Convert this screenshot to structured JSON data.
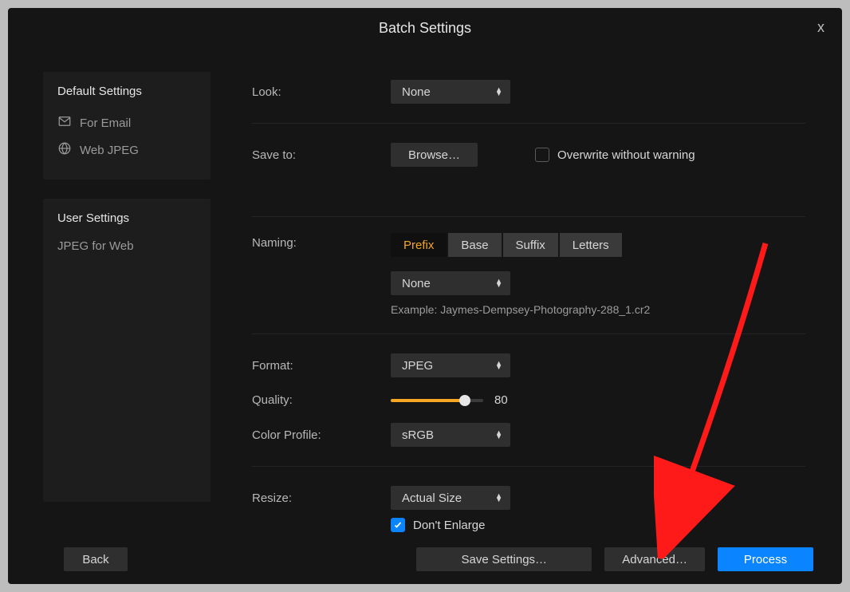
{
  "title": "Batch Settings",
  "sidebar": {
    "default_heading": "Default Settings",
    "default_items": [
      {
        "icon": "mail",
        "label": "For Email"
      },
      {
        "icon": "globe",
        "label": "Web JPEG"
      }
    ],
    "user_heading": "User Settings",
    "user_items": [
      {
        "label": "JPEG for Web"
      }
    ]
  },
  "form": {
    "look_label": "Look:",
    "look_value": "None",
    "save_to_label": "Save to:",
    "browse_label": "Browse…",
    "overwrite_label": "Overwrite without warning",
    "overwrite_checked": false,
    "naming_label": "Naming:",
    "naming_tabs": [
      "Prefix",
      "Base",
      "Suffix",
      "Letters"
    ],
    "naming_active_tab": "Prefix",
    "naming_value": "None",
    "naming_example": "Example: Jaymes-Dempsey-Photography-288_1.cr2",
    "format_label": "Format:",
    "format_value": "JPEG",
    "quality_label": "Quality:",
    "quality_value": 80,
    "color_profile_label": "Color Profile:",
    "color_profile_value": "sRGB",
    "resize_label": "Resize:",
    "resize_value": "Actual Size",
    "dont_enlarge_label": "Don't Enlarge",
    "dont_enlarge_checked": true
  },
  "footer": {
    "back": "Back",
    "save_settings": "Save Settings…",
    "advanced": "Advanced…",
    "process": "Process"
  },
  "colors": {
    "accent_orange": "#f5a623",
    "accent_blue": "#0a84ff",
    "arrow_red": "#ff1a1a"
  }
}
